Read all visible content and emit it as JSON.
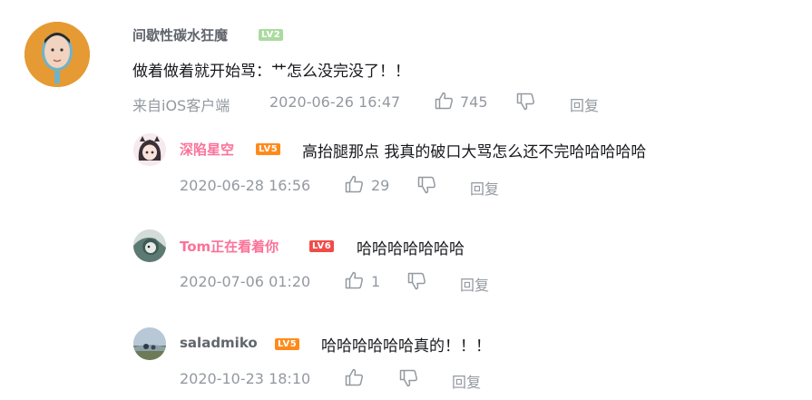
{
  "main_comment": {
    "username": "间歇性碳水狂魔",
    "level": "LV2",
    "content": "做着做着就开始骂：艹怎么没完没了！！",
    "source": "来自iOS客户端",
    "time": "2020-06-26 16:47",
    "likes": "745",
    "reply_label": "回复"
  },
  "replies": [
    {
      "username": "深陷星空",
      "level": "LV5",
      "content": "高抬腿那点 我真的破口大骂怎么还不完哈哈哈哈哈",
      "time": "2020-06-28 16:56",
      "likes": "29",
      "reply_label": "回复"
    },
    {
      "username": "Tom正在看着你",
      "level": "LV6",
      "content": "哈哈哈哈哈哈哈",
      "time": "2020-07-06 01:20",
      "likes": "1",
      "reply_label": "回复"
    },
    {
      "username": "saladmiko",
      "level": "LV5",
      "content": "哈哈哈哈哈哈真的！！！",
      "time": "2020-10-23 18:10",
      "likes": "",
      "reply_label": "回复"
    }
  ],
  "icons": {
    "like": "thumbs-up-icon",
    "dislike": "thumbs-down-icon"
  },
  "colors": {
    "pink_name": "#fb7299",
    "meta_gray": "#9499a0",
    "lv2": "#aadb9f",
    "lv5": "#ff8a1a",
    "lv6": "#f04c49"
  }
}
